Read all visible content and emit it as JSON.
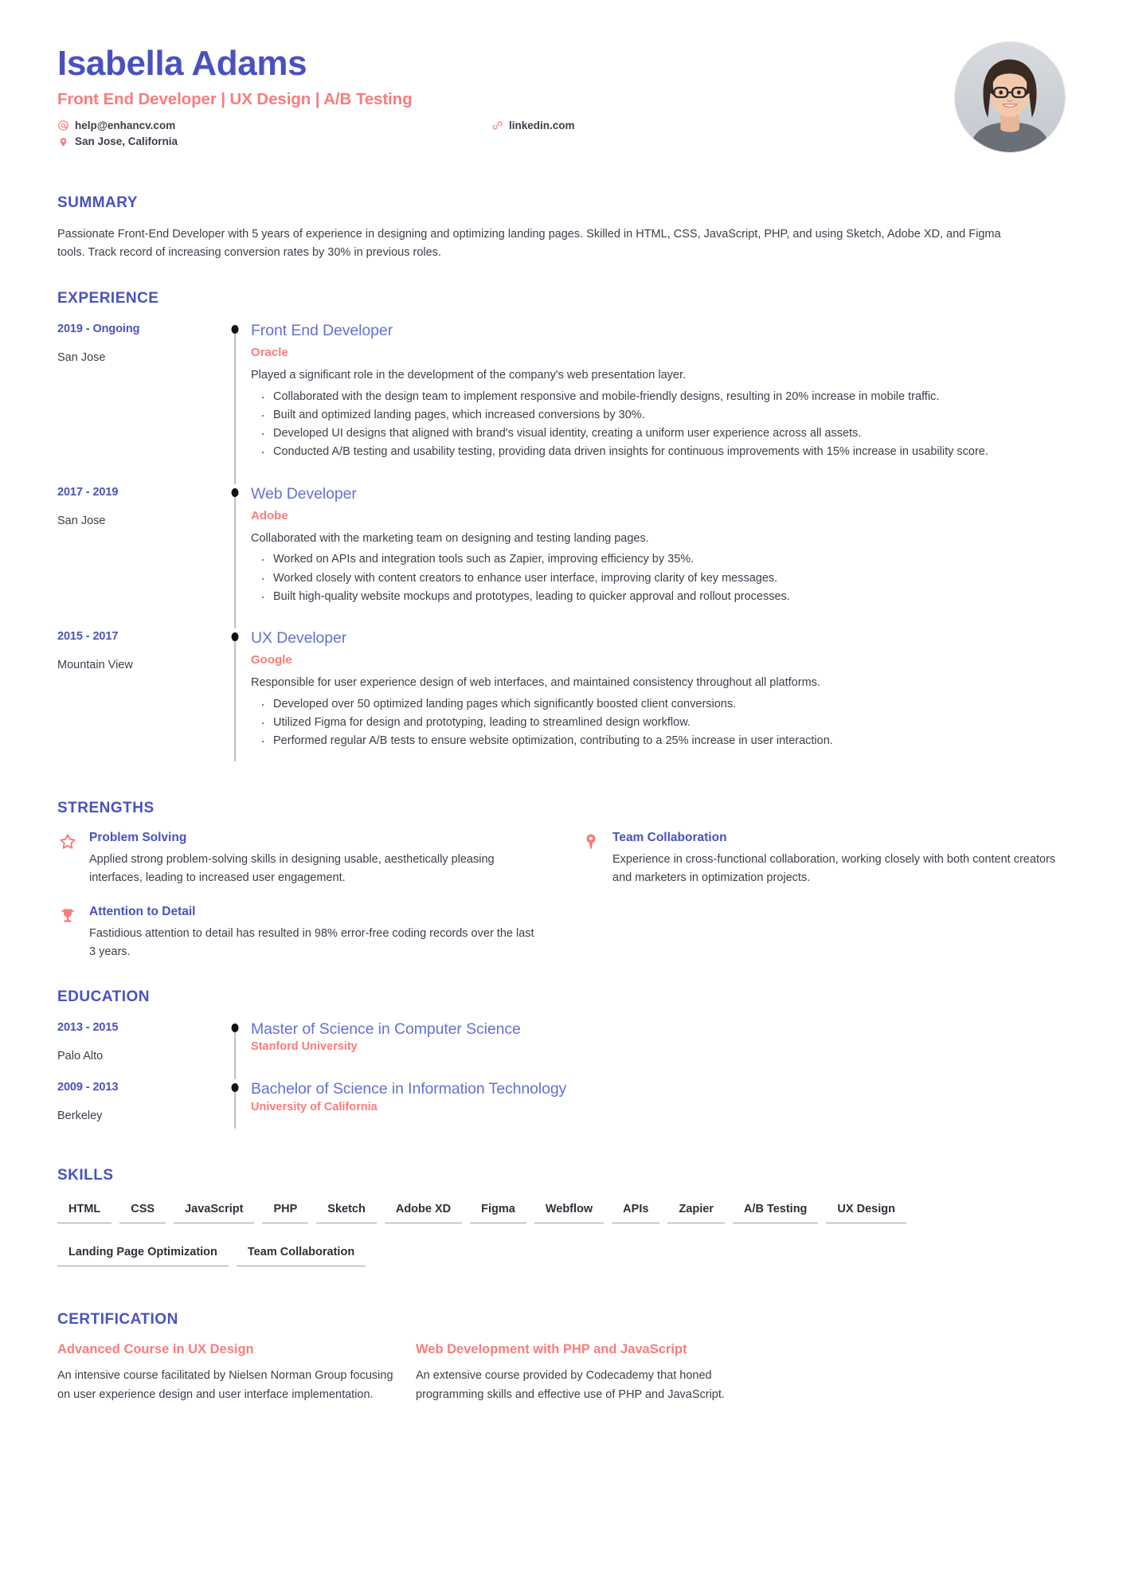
{
  "header": {
    "name": "Isabella Adams",
    "role": "Front End Developer | UX Design | A/B Testing",
    "email": "help@enhancv.com",
    "email_icon": "at-icon",
    "link": "linkedin.com",
    "link_icon": "link-icon",
    "location": "San Jose, California",
    "location_icon": "map-pin-icon",
    "avatar_alt": "profile-photo"
  },
  "colors": {
    "primary": "#4a51bf",
    "title_link": "#6570d4",
    "accent": "#fa7c7c",
    "text": "#3b3f4a",
    "rail": "#b9bcc2",
    "dot": "#111216"
  },
  "summary": {
    "title": "SUMMARY",
    "text": "Passionate Front-End Developer with 5 years of experience in designing and optimizing landing pages. Skilled in HTML, CSS, JavaScript, PHP, and using Sketch, Adobe XD, and Figma tools. Track record of increasing conversion rates by 30% in previous roles."
  },
  "experience": {
    "title": "EXPERIENCE",
    "entries": [
      {
        "date": "2019 - Ongoing",
        "location": "San Jose",
        "position": "Front End Developer",
        "company": "Oracle",
        "description": "Played a significant role in the development of the company's web presentation layer.",
        "bullets": [
          "Collaborated with the design team to implement responsive and mobile-friendly designs, resulting in 20% increase in mobile traffic.",
          "Built and optimized landing pages, which increased conversions by 30%.",
          "Developed UI designs that aligned with brand's visual identity, creating a uniform user experience across all assets.",
          "Conducted A/B testing and usability testing, providing data driven insights for continuous improvements with 15% increase in usability score."
        ]
      },
      {
        "date": "2017 - 2019",
        "location": "San Jose",
        "position": "Web Developer",
        "company": "Adobe",
        "description": "Collaborated with the marketing team on designing and testing landing pages.",
        "bullets": [
          "Worked on APIs and integration tools such as Zapier, improving efficiency by 35%.",
          "Worked closely with content creators to enhance user interface, improving clarity of key messages.",
          "Built high-quality website mockups and prototypes, leading to quicker approval and rollout processes."
        ]
      },
      {
        "date": "2015 - 2017",
        "location": "Mountain View",
        "position": "UX Developer",
        "company": "Google",
        "description": "Responsible for user experience design of web interfaces, and maintained consistency throughout all platforms.",
        "bullets": [
          "Developed over 50 optimized landing pages which significantly boosted client conversions.",
          "Utilized Figma for design and prototyping, leading to streamlined design workflow.",
          "Performed regular A/B tests to ensure website optimization, contributing to a 25% increase in user interaction."
        ]
      }
    ]
  },
  "strengths": {
    "title": "STRENGTHS",
    "items": [
      {
        "icon": "star-icon",
        "title": "Problem Solving",
        "description": "Applied strong problem-solving skills in designing usable, aesthetically pleasing interfaces, leading to increased user engagement."
      },
      {
        "icon": "balloon-pin-icon",
        "title": "Team Collaboration",
        "description": "Experience in cross-functional collaboration, working closely with both content creators and marketers in optimization projects."
      },
      {
        "icon": "trophy-icon",
        "title": "Attention to Detail",
        "description": "Fastidious attention to detail has resulted in 98% error-free coding records over the last 3 years."
      }
    ]
  },
  "education": {
    "title": "EDUCATION",
    "entries": [
      {
        "date": "2013 - 2015",
        "location": "Palo Alto",
        "degree": "Master of Science in Computer Science",
        "school": "Stanford University"
      },
      {
        "date": "2009 - 2013",
        "location": "Berkeley",
        "degree": "Bachelor of Science in Information Technology",
        "school": "University of California"
      }
    ]
  },
  "skills": {
    "title": "SKILLS",
    "items": [
      "HTML",
      "CSS",
      "JavaScript",
      "PHP",
      "Sketch",
      "Adobe XD",
      "Figma",
      "Webflow",
      "APIs",
      "Zapier",
      "A/B Testing",
      "UX Design",
      "Landing Page Optimization",
      "Team Collaboration"
    ]
  },
  "certification": {
    "title": "CERTIFICATION",
    "items": [
      {
        "name": "Advanced Course in UX Design",
        "description": "An intensive course facilitated by Nielsen Norman Group focusing on user experience design and user interface implementation."
      },
      {
        "name": "Web Development with PHP and JavaScript",
        "description": "An extensive course provided by Codecademy that honed programming skills and effective use of PHP and JavaScript."
      }
    ]
  }
}
